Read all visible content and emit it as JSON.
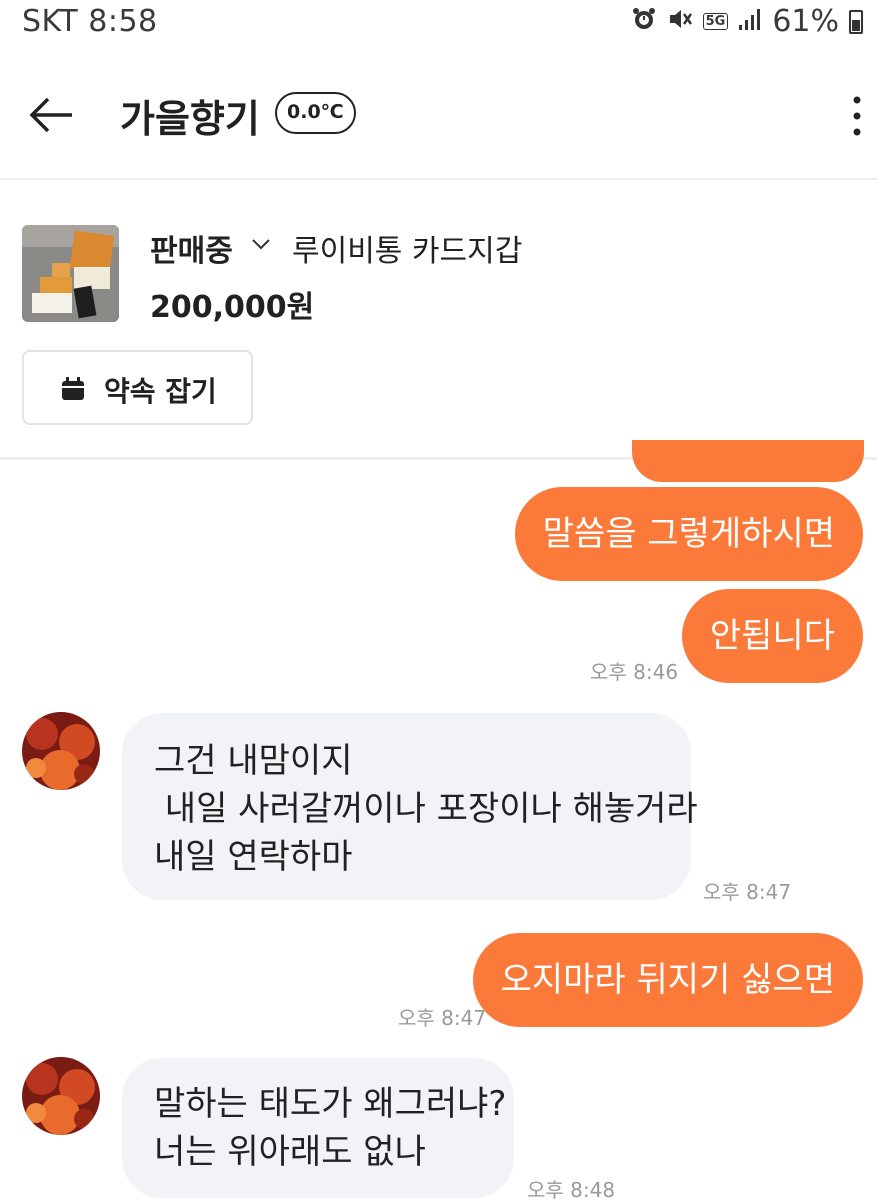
{
  "status_bar": {
    "carrier_time": "SKT 8:58",
    "battery": "61%",
    "network": "5G",
    "icons": [
      "alarm-icon",
      "mute-icon",
      "5g-icon",
      "signal-icon",
      "battery-icon"
    ]
  },
  "header": {
    "title": "가을향기",
    "temperature": "0.0℃"
  },
  "product": {
    "status": "판매중",
    "name": "루이비통 카드지갑",
    "price": "200,000원",
    "appointment_label": "약속 잡기"
  },
  "messages": [
    {
      "direction": "out",
      "text": "말씀을 그렇게하시면"
    },
    {
      "direction": "out",
      "text": "안됩니다",
      "time": "오후 8:46"
    },
    {
      "direction": "in",
      "lines": [
        "그건 내맘이지",
        " 내일 사러갈꺼이나 포장이나 해놓거라",
        "내일 연락하마"
      ],
      "time": "오후 8:47"
    },
    {
      "direction": "out",
      "text": "오지마라 뒤지기 싫으면",
      "time": "오후 8:47"
    },
    {
      "direction": "in",
      "lines": [
        "말하는 태도가 왜그러냐?",
        "너는 위아래도 없나"
      ],
      "time": "오후 8:48"
    }
  ],
  "colors": {
    "accent": "#fb7a3a",
    "incoming_bubble": "#f2f3f6",
    "text": "#212124",
    "timestamp": "#9a9a9a"
  }
}
